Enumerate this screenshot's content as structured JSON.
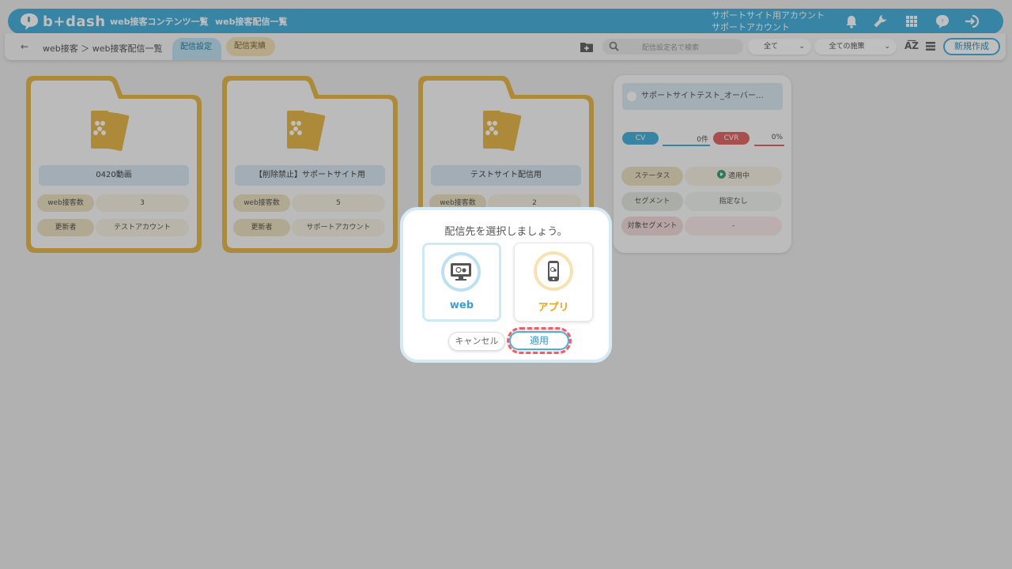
{
  "app": {
    "logo_text": "b+dash",
    "nav": [
      "web接客コンテンツ一覧",
      "web接客配信一覧"
    ],
    "account_line1": "サポートサイト用アカウント",
    "account_line2": "サポートアカウント"
  },
  "toolbar": {
    "back_symbol": "←",
    "breadcrumb": "web接客 ＞ web接客配信一覧",
    "tab_active": "配信設定",
    "tab_other": "配信実績",
    "search_placeholder": "配信設定名で検索",
    "filter_scope": "全て",
    "filter_measure": "全ての施策",
    "chevron": "⌄",
    "sort_label": "A͞Z",
    "new_button": "新規作成"
  },
  "folders": [
    {
      "title": "0420動画",
      "rows": [
        {
          "key": "web接客数",
          "value": "3"
        },
        {
          "key": "更新者",
          "value": "テストアカウント"
        }
      ]
    },
    {
      "title": "【削除禁止】サポートサイト用",
      "rows": [
        {
          "key": "web接客数",
          "value": "5"
        },
        {
          "key": "更新者",
          "value": "サポートアカウント"
        }
      ]
    },
    {
      "title": "テストサイト配信用",
      "rows": [
        {
          "key": "web接客数",
          "value": "2"
        }
      ]
    }
  ],
  "detail": {
    "title": "サポートサイトテスト_オーバー…",
    "cv_label": "CV",
    "cv_value": "0件",
    "cvr_label": "CVR",
    "cvr_value": "0%",
    "status_key": "ステータス",
    "status_value": "適用中",
    "segment_key": "セグメント",
    "segment_value": "指定なし",
    "target_key": "対象セグメント",
    "target_value": "-"
  },
  "modal": {
    "title": "配信先を選択しましょう。",
    "option_web": "web",
    "option_app": "アプリ",
    "cancel": "キャンセル",
    "apply": "適用"
  },
  "colors": {
    "brand": "#4ab1dc",
    "folder": "#e7b84d",
    "cv": "#4ab1dc",
    "cvr": "#e06969",
    "highlight": "#ec5f6b"
  }
}
